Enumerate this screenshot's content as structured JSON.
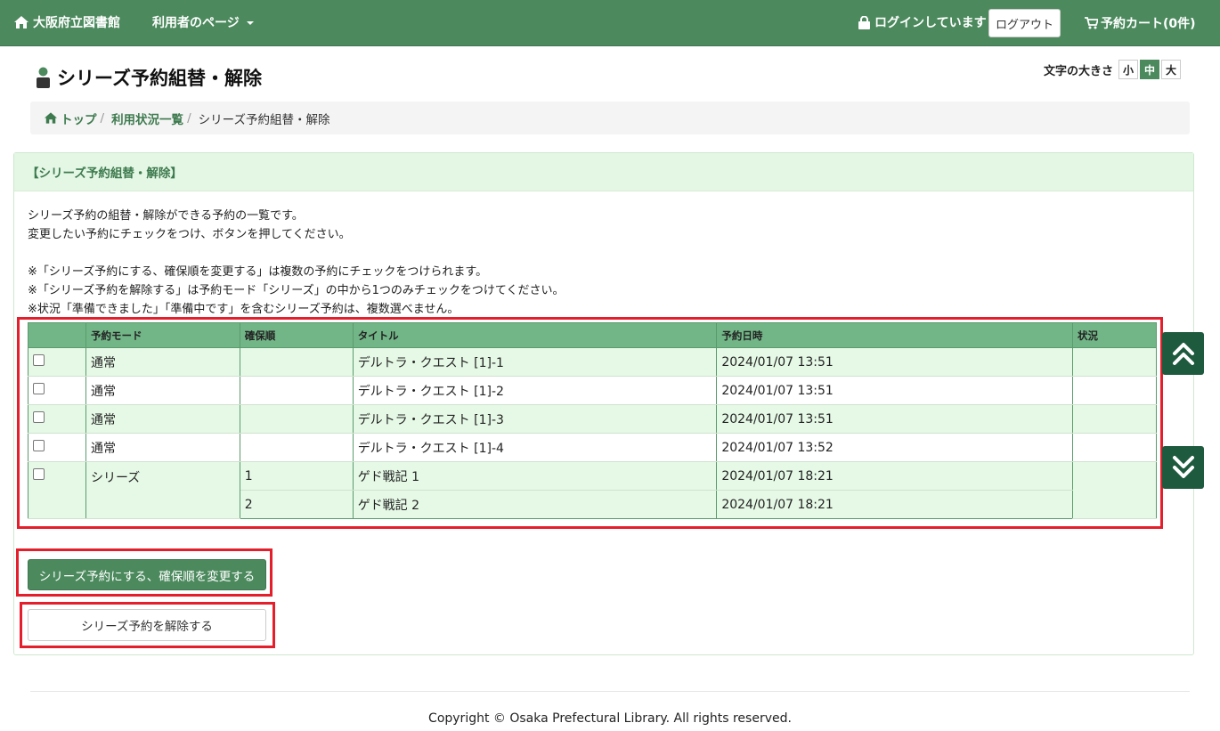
{
  "nav": {
    "home": "大阪府立図書館",
    "user_menu": "利用者のページ",
    "login_status": "ログインしています",
    "logout": "ログアウト",
    "cart": "予約カート(0件)"
  },
  "header": {
    "title": "シリーズ予約組替・解除",
    "fontsize_label": "文字の大きさ",
    "fontsize_options": [
      "小",
      "中",
      "大"
    ],
    "fontsize_selected": "中"
  },
  "breadcrumb": {
    "top": "トップ",
    "list": "利用状況一覧",
    "current": "シリーズ予約組替・解除"
  },
  "panel": {
    "heading": "【シリーズ予約組替・解除】",
    "lines": [
      "シリーズ予約の組替・解除ができる予約の一覧です。",
      "変更したい予約にチェックをつけ、ボタンを押してください。",
      "",
      "※「シリーズ予約にする、確保順を変更する」は複数の予約にチェックをつけられます。",
      "※「シリーズ予約を解除する」は予約モード「シリーズ」の中から1つのみチェックをつけてください。",
      "※状況「準備できました」「準備中です」を含むシリーズ予約は、複数選べません。"
    ]
  },
  "table": {
    "headers": [
      "",
      "予約モード",
      "確保順",
      "タイトル",
      "予約日時",
      "状況"
    ],
    "rows": [
      {
        "mode": "通常",
        "order": "",
        "title": "デルトラ・クエスト [1]-1",
        "date": "2024/01/07 13:51",
        "status": ""
      },
      {
        "mode": "通常",
        "order": "",
        "title": "デルトラ・クエスト [1]-2",
        "date": "2024/01/07 13:51",
        "status": ""
      },
      {
        "mode": "通常",
        "order": "",
        "title": "デルトラ・クエスト [1]-3",
        "date": "2024/01/07 13:51",
        "status": ""
      },
      {
        "mode": "通常",
        "order": "",
        "title": "デルトラ・クエスト [1]-4",
        "date": "2024/01/07 13:52",
        "status": ""
      },
      {
        "mode": "シリーズ",
        "order": "1",
        "title": "ゲド戦記 1",
        "date": "2024/01/07 18:21",
        "status": ""
      },
      {
        "mode": "",
        "order": "2",
        "title": "ゲド戦記 2",
        "date": "2024/01/07 18:21",
        "status": ""
      }
    ]
  },
  "buttons": {
    "make_series": "シリーズ予約にする、確保順を変更する",
    "release_series": "シリーズ予約を解除する"
  },
  "footer": {
    "copyright": "Copyright © Osaka Prefectural Library. All rights reserved."
  },
  "colors": {
    "brand": "#4c8a5e",
    "table_header": "#72b587",
    "row_alt": "#e6f9e6",
    "highlight": "#e41e2b",
    "scroll_button": "#1e5a3e"
  }
}
